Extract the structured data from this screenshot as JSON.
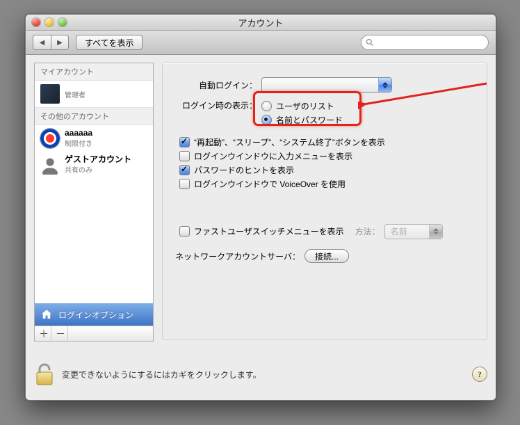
{
  "window": {
    "title": "アカウント"
  },
  "toolbar": {
    "show_all": "すべてを表示",
    "search_placeholder": ""
  },
  "sidebar": {
    "header_my": "マイアカウント",
    "header_other": "その他のアカウント",
    "accounts": [
      {
        "name": "",
        "role": "管理者"
      },
      {
        "name": "aaaaaa",
        "role": "制限付き"
      },
      {
        "name": "ゲストアカウント",
        "role": "共有のみ"
      }
    ],
    "login_options": "ログインオプション"
  },
  "pane": {
    "auto_login_label": "自動ログイン：",
    "auto_login_value": "",
    "login_display_label": "ログイン時の表示：",
    "radio_userlist": "ユーザのリスト",
    "radio_namepw": "名前とパスワード",
    "radio_selected": "namepw",
    "cb_restart": "“再起動”、“スリープ”、“システム終了”ボタンを表示",
    "cb_restart_checked": true,
    "cb_input_menu": "ログインウインドウに入力メニューを表示",
    "cb_input_menu_checked": false,
    "cb_hint": "パスワードのヒントを表示",
    "cb_hint_checked": true,
    "cb_voiceover": "ログインウインドウで VoiceOver を使用",
    "cb_voiceover_checked": false,
    "cb_fast_switch": "ファストユーザスイッチメニューを表示",
    "cb_fast_switch_checked": false,
    "fast_method_label": "方法：",
    "fast_method_value": "名前",
    "net_server_label": "ネットワークアカウントサーバ：",
    "net_connect_btn": "接続..."
  },
  "footer": {
    "lock_text": "変更できないようにするにはカギをクリックします。"
  }
}
